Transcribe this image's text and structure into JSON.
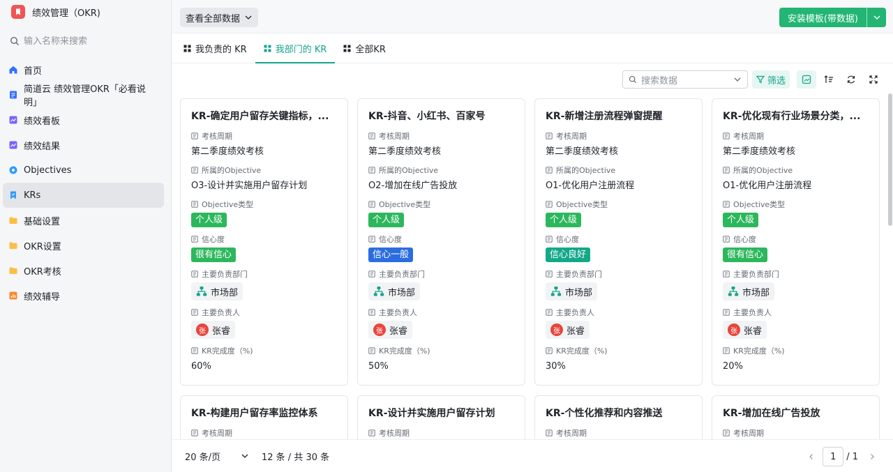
{
  "app": {
    "title": "绩效管理（OKR)"
  },
  "sidebar": {
    "search_placeholder": "输入名称来搜索",
    "items": [
      {
        "label": "首页",
        "icon": "home-icon",
        "color": "#3370ff"
      },
      {
        "label": "简道云 绩效管理OKR「必看说明」",
        "icon": "document-icon",
        "color": "#3370ff"
      },
      {
        "label": "绩效看板",
        "icon": "dashboard-chart-icon",
        "color": "#7b61ff"
      },
      {
        "label": "绩效结果",
        "icon": "result-chart-icon",
        "color": "#7b61ff"
      },
      {
        "label": "Objectives",
        "icon": "target-icon",
        "color": "#2f9bff"
      },
      {
        "label": "KRs",
        "icon": "bookmark-icon",
        "color": "#2f9bff",
        "active": true
      },
      {
        "label": "基础设置",
        "icon": "folder-icon",
        "color": "#fbbf45"
      },
      {
        "label": "OKR设置",
        "icon": "folder-icon",
        "color": "#fbbf45"
      },
      {
        "label": "OKR考核",
        "icon": "folder-icon",
        "color": "#fbbf45"
      },
      {
        "label": "绩效辅导",
        "icon": "report-icon",
        "color": "#f78b2f"
      }
    ]
  },
  "topbar": {
    "view_button": "查看全部数据",
    "install_button": "安装模板(带数据)"
  },
  "tabs": [
    {
      "label": "我负责的 KR",
      "active": false
    },
    {
      "label": "我部门的 KR",
      "active": true
    },
    {
      "label": "全部KR",
      "active": false
    }
  ],
  "toolbar": {
    "search_placeholder": "搜索数据",
    "filter_label": "筛选"
  },
  "field_labels": {
    "period": "考核周期",
    "objective": "所属的Objective",
    "type": "Objective类型",
    "confidence": "信心度",
    "dept": "主要负责部门",
    "owner": "主要负责人",
    "progress": "KR完成度（%)"
  },
  "cards": [
    {
      "title": "KR-确定用户留存关键指标，...",
      "period": "第二季度绩效考核",
      "objective": "O3-设计并实施用户留存计划",
      "type": "个人级",
      "confidence": "很有信心",
      "confidence_color": "#2db75d",
      "dept": "市场部",
      "owner": "张睿",
      "owner_initial": "张",
      "progress": "60%"
    },
    {
      "title": "KR-抖音、小红书、百家号",
      "period": "第二季度绩效考核",
      "objective": "O2-增加在线广告投放",
      "type": "个人级",
      "confidence": "信心一般",
      "confidence_color": "#2b6de0",
      "dept": "市场部",
      "owner": "张睿",
      "owner_initial": "张",
      "progress": "50%"
    },
    {
      "title": "KR-新增注册流程弹窗提醒",
      "period": "第二季度绩效考核",
      "objective": "O1-优化用户注册流程",
      "type": "个人级",
      "confidence": "信心良好",
      "confidence_color": "#14a889",
      "dept": "市场部",
      "owner": "张睿",
      "owner_initial": "张",
      "progress": "30%"
    },
    {
      "title": "KR-优化现有行业场景分类，...",
      "period": "第二季度绩效考核",
      "objective": "O1-优化用户注册流程",
      "type": "个人级",
      "confidence": "很有信心",
      "confidence_color": "#2db75d",
      "dept": "市场部",
      "owner": "张睿",
      "owner_initial": "张",
      "progress": "20%"
    },
    {
      "title": "KR-构建用户留存率监控体系",
      "period": "考核周期"
    },
    {
      "title": "KR-设计并实施用户留存计划",
      "period": "考核周期"
    },
    {
      "title": "KR-个性化推荐和内容推送",
      "period": "考核周期"
    },
    {
      "title": "KR-增加在线广告投放",
      "period": "考核周期"
    }
  ],
  "footer": {
    "page_size": "20 条/页",
    "count": "12 条 / 共 30 条",
    "current_page": "1",
    "total_pages": "/ 1"
  },
  "colors": {
    "accent": "#14a38b",
    "install_button": "#22b573",
    "type_tag": "#2db75d"
  }
}
